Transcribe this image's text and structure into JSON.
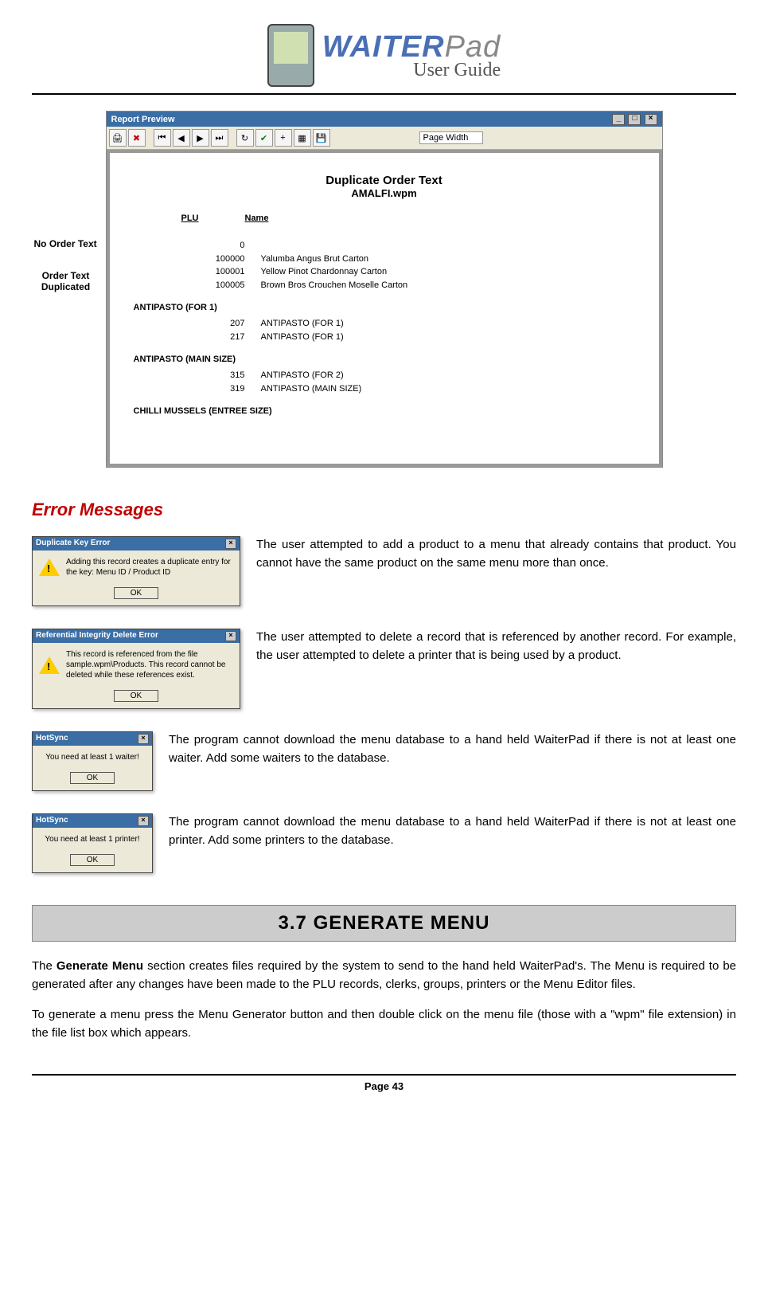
{
  "header": {
    "brand_main": "WAITER",
    "brand_pad": "Pad",
    "brand_sub": "User Guide"
  },
  "report": {
    "window_title": "Report Preview",
    "zoom_select": "Page Width",
    "title": "Duplicate Order Text",
    "subtitle": "AMALFI.wpm",
    "col_plu": "PLU",
    "col_name": "Name",
    "callout_no_order": "No Order Text",
    "callout_duplicated": "Order Text Duplicated",
    "group1": [
      {
        "plu": "0",
        "name": ""
      },
      {
        "plu": "100000",
        "name": "Yalumba Angus Brut Carton"
      },
      {
        "plu": "100001",
        "name": "Yellow Pinot Chardonnay Carton"
      },
      {
        "plu": "100005",
        "name": "Brown Bros Crouchen Moselle Carton"
      }
    ],
    "section2_head": "ANTIPASTO (FOR 1)",
    "group2": [
      {
        "plu": "207",
        "name": "ANTIPASTO (FOR 1)"
      },
      {
        "plu": "217",
        "name": "ANTIPASTO (FOR 1)"
      }
    ],
    "section3_head": "ANTIPASTO (MAIN SIZE)",
    "group3": [
      {
        "plu": "315",
        "name": "ANTIPASTO (FOR 2)"
      },
      {
        "plu": "319",
        "name": "ANTIPASTO (MAIN SIZE)"
      }
    ],
    "section4_head": "CHILLI MUSSELS (ENTREE SIZE)"
  },
  "errors": {
    "heading": "Error Messages",
    "items": [
      {
        "dlg_title": "Duplicate Key Error",
        "dlg_text": "Adding this record creates a duplicate entry for the key: Menu ID / Product ID",
        "ok": "OK",
        "desc": "The user attempted to add a product to a menu that already contains that product. You cannot have the same product on the same menu more than once.",
        "width": "w260"
      },
      {
        "dlg_title": "Referential Integrity Delete Error",
        "dlg_text": "This record is referenced from the file sample.wpm\\Products. This record cannot be deleted while these references exist.",
        "ok": "OK",
        "desc": "The user attempted to delete a record that is referenced by another record. For example, the user attempted to delete a printer that is being used by a product.",
        "width": "w260"
      },
      {
        "dlg_title": "HotSync",
        "dlg_text": "You need at least 1 waiter!",
        "ok": "OK",
        "desc": "The program cannot download the menu database to a hand held WaiterPad if there is not at least one waiter. Add some waiters to the database.",
        "width": "w150"
      },
      {
        "dlg_title": "HotSync",
        "dlg_text": "You need at least 1 printer!",
        "ok": "OK",
        "desc": "The program cannot download the menu database to a hand held WaiterPad if there is not at least one printer. Add some printers to the database.",
        "width": "w150"
      }
    ]
  },
  "section_bar": "3.7    GENERATE MENU",
  "body": {
    "p1_prefix": "The ",
    "p1_bold": "Generate Menu",
    "p1_rest": " section creates files required by the system to send to the hand held WaiterPad's. The Menu is required to be generated after any changes have been made to the PLU records, clerks, groups, printers or the Menu Editor files.",
    "p2": "To generate a menu press the Menu Generator button and then double click on the menu file (those with a \"wpm\" file extension) in the file list box which appears."
  },
  "footer": "Page 43"
}
